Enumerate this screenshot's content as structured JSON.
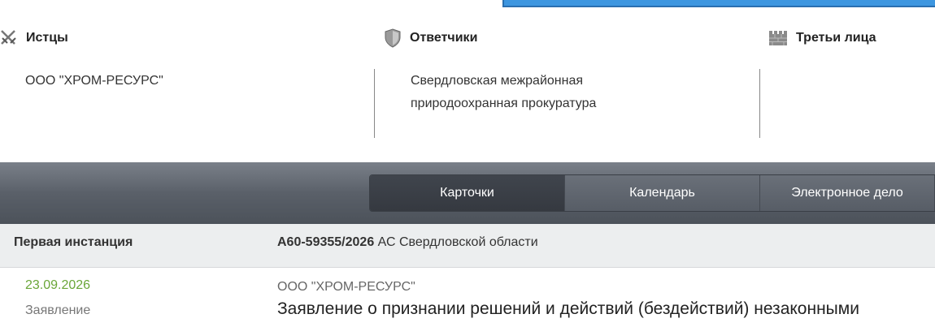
{
  "parties": {
    "plaintiffs": {
      "title": "Истцы",
      "icon": "crossed-swords-icon",
      "items": [
        "ООО \"ХРОМ-РЕСУРС\""
      ]
    },
    "defendants": {
      "title": "Ответчики",
      "icon": "shield-icon",
      "items": [
        "Свердловская межрайонная",
        "природоохранная прокуратура"
      ]
    },
    "third_parties": {
      "title": "Третьи лица",
      "icon": "castle-wall-icon",
      "items": []
    }
  },
  "tabs": [
    {
      "label": "Карточки",
      "active": true
    },
    {
      "label": "Календарь",
      "active": false
    },
    {
      "label": "Электронное дело",
      "active": false
    }
  ],
  "instance": {
    "label": "Первая инстанция",
    "case_number": "А60-59355/2026",
    "court": "АС Свердловской области"
  },
  "entry": {
    "date": "23.09.2026",
    "type": "Заявление",
    "party": "ООО \"ХРОМ-РЕСУРС\"",
    "title": "Заявление о признании решений и действий (бездействий) незаконными"
  },
  "colors": {
    "accent_blue": "#3d96e0",
    "date_green": "#6aa638",
    "tabbar": "#5a6069"
  }
}
